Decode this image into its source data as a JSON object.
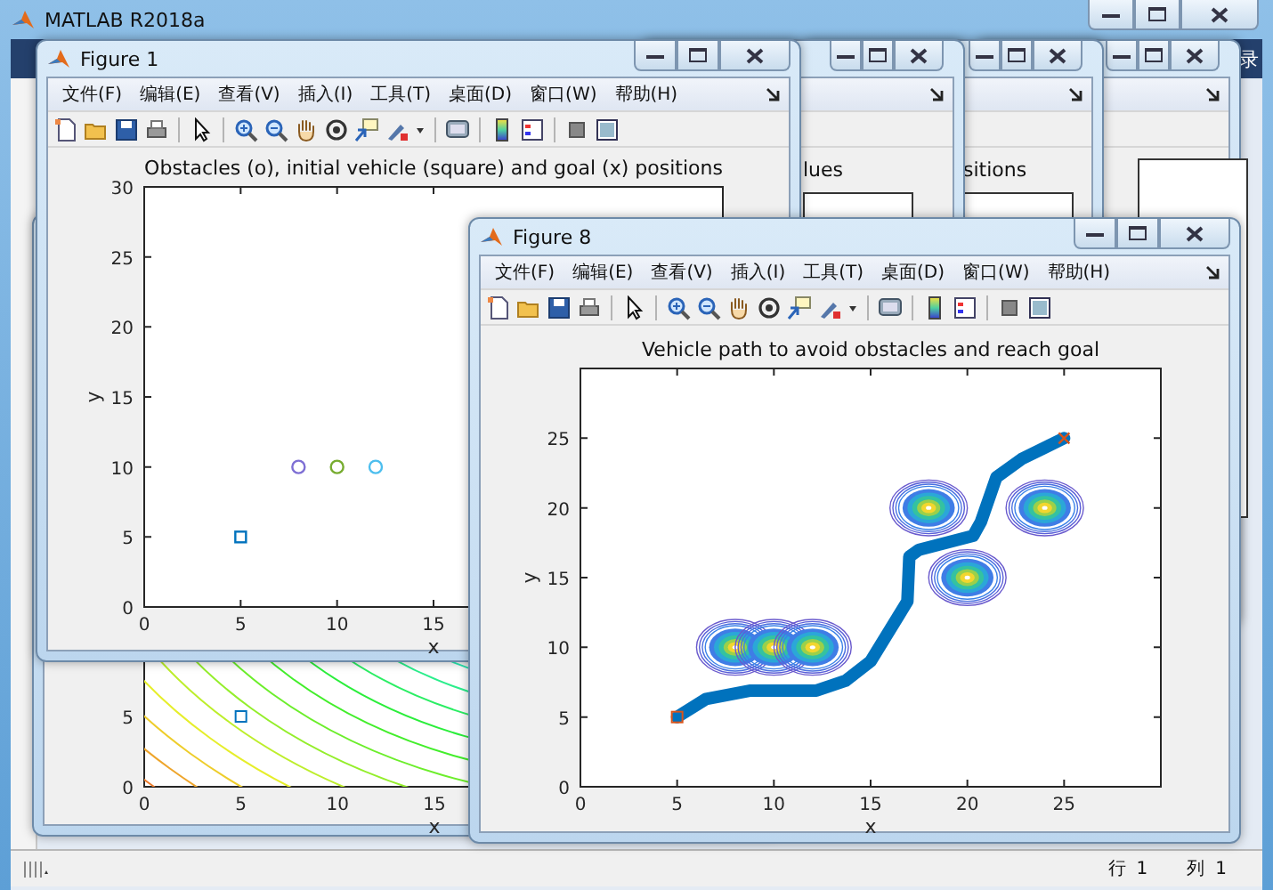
{
  "main_window": {
    "title": "MATLAB R2018a",
    "corner_text": "录",
    "status_bar": {
      "row_label": "行",
      "row": "1",
      "column_label": "列",
      "column": "1"
    }
  },
  "background_figures": [
    {
      "kind": "figure",
      "visible_title": "lues"
    },
    {
      "kind": "figure",
      "visible_title": "sitions"
    },
    {
      "kind": "figure"
    }
  ],
  "contour_figure": {
    "xlabel": "x",
    "xticks": [
      "0",
      "5",
      "10",
      "15"
    ],
    "yticks": [
      "5",
      "0"
    ]
  },
  "figure_1": {
    "title": "Figure 1",
    "menus": [
      "文件(F)",
      "编辑(E)",
      "查看(V)",
      "插入(I)",
      "工具(T)",
      "桌面(D)",
      "窗口(W)",
      "帮助(H)"
    ],
    "chart_data": {
      "type": "scatter",
      "title": "Obstacles (o), initial vehicle (square) and goal (x) positions",
      "xlabel": "x",
      "ylabel": "y",
      "xlim": [
        0,
        30
      ],
      "ylim": [
        0,
        30
      ],
      "xticks": [
        0,
        5,
        10,
        15
      ],
      "yticks": [
        0,
        5,
        10,
        15,
        20,
        25,
        30
      ],
      "x": [
        5,
        8,
        10,
        12
      ],
      "series": [
        {
          "marker": "square",
          "color": "#0072bd",
          "values": [
            5,
            null,
            null,
            null
          ]
        },
        {
          "marker": "circle",
          "color": "#7e6fd4",
          "values": [
            null,
            10,
            null,
            null
          ]
        },
        {
          "marker": "circle",
          "color": "#77ac30",
          "values": [
            null,
            null,
            10,
            null
          ]
        },
        {
          "marker": "circle",
          "color": "#4dbeee",
          "values": [
            null,
            null,
            null,
            10
          ]
        }
      ]
    }
  },
  "figure_8": {
    "title": "Figure 8",
    "menus": [
      "文件(F)",
      "编辑(E)",
      "查看(V)",
      "插入(I)",
      "工具(T)",
      "桌面(D)",
      "窗口(W)",
      "帮助(H)"
    ],
    "chart_data": {
      "type": "line",
      "title": "Vehicle path to avoid obstacles and reach goal",
      "xlabel": "x",
      "ylabel": "y",
      "xlim": [
        0,
        30
      ],
      "ylim": [
        0,
        30
      ],
      "xticks": [
        0,
        5,
        10,
        15,
        20,
        25
      ],
      "yticks": [
        0,
        5,
        10,
        15,
        20,
        25
      ],
      "x": [
        5,
        6.5,
        8.8,
        12.2,
        13.7,
        15,
        16.9,
        17,
        17.5,
        20.3,
        20.7,
        21.5,
        22.8,
        25
      ],
      "series": [
        {
          "color": "#0072bd",
          "values": [
            5,
            6.3,
            6.9,
            6.9,
            7.6,
            9,
            13.3,
            16.5,
            17,
            18,
            19,
            22.2,
            23.5,
            25
          ]
        }
      ]
    }
  }
}
